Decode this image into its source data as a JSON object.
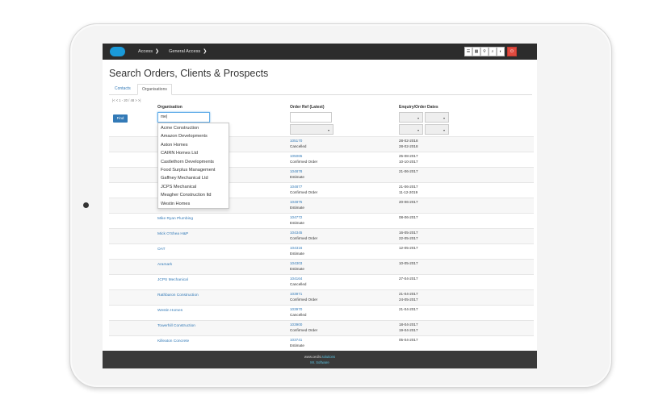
{
  "nav": {
    "crumbs": [
      "Access",
      "General Access"
    ],
    "buttons": [
      "☰",
      "▦",
      "⚲",
      "⌕",
      "◐",
      "⏻"
    ]
  },
  "page": {
    "title": "Search Orders, Clients & Prospects",
    "tabs": [
      "Contacts",
      "Organisations"
    ],
    "active_tab": "Organisations",
    "pager": "|< < 1 - 20 / 48 > >|"
  },
  "columns": {
    "organisation": "Organisation",
    "order_ref": "Order Ref (Latest)",
    "dates": "Enquiry/Order Dates"
  },
  "filters": {
    "find_label": "Find",
    "org_value": "me|"
  },
  "dropdown": [
    "Acme Construction",
    "Amazon Developments",
    "Aston Homes",
    "CAIRN Homes Ltd",
    "Castlethorn Developments",
    "Food Surplus Management",
    "Gaffney Mechanical Ltd",
    "JCPS Mechanical",
    "Meagher Construction ltd",
    "Westin Homes"
  ],
  "rows": [
    {
      "org": "",
      "order": "105170",
      "status": "Cancelled",
      "d1": "28-02-2018",
      "d2": "28-02-2018"
    },
    {
      "org": "",
      "order": "105065",
      "status": "Confirmed Order",
      "d1": "25-08-2017",
      "d2": "10-10-2017"
    },
    {
      "org": "",
      "order": "104878",
      "status": "Estimate",
      "d1": "21-06-2017",
      "d2": ""
    },
    {
      "org": "",
      "order": "104877",
      "status": "Confirmed Order",
      "d1": "21-06-2017",
      "d2": "11-12-2019"
    },
    {
      "org": "",
      "order": "104875",
      "status": "Estimate",
      "d1": "20-06-2017",
      "d2": ""
    },
    {
      "org": "Mike Ryan Plumbing",
      "order": "104772",
      "status": "Estimate",
      "d1": "08-06-2017",
      "d2": ""
    },
    {
      "org": "Mick O'Shea H&P",
      "order": "104345",
      "status": "Confirmed Order",
      "d1": "16-05-2017",
      "d2": "22-05-2017"
    },
    {
      "org": "OAT",
      "order": "104316",
      "status": "Estimate",
      "d1": "12-05-2017",
      "d2": ""
    },
    {
      "org": "Aramark",
      "order": "104303",
      "status": "Estimate",
      "d1": "10-05-2017",
      "d2": ""
    },
    {
      "org": "JCPS Mechanical",
      "order": "104164",
      "status": "Cancelled",
      "d1": "27-04-2017",
      "d2": ""
    },
    {
      "org": "Rathbaron Construction",
      "order": "103971",
      "status": "Confirmed Order",
      "d1": "21-04-2017",
      "d2": "24-05-2017"
    },
    {
      "org": "Westin Homes",
      "order": "103970",
      "status": "Cancelled",
      "d1": "21-04-2017",
      "d2": ""
    },
    {
      "org": "Towerhill Construction",
      "order": "103900",
      "status": "Confirmed Order",
      "d1": "18-04-2017",
      "d2": "19-04-2017"
    },
    {
      "org": "Killeaton Concrete",
      "order": "103741",
      "status": "Estimate",
      "d1": "05-04-2017",
      "d2": ""
    }
  ],
  "footer": {
    "line1": "www.cecils.",
    "line1_highlight": "solutions",
    "line2": "Mr. Software"
  }
}
